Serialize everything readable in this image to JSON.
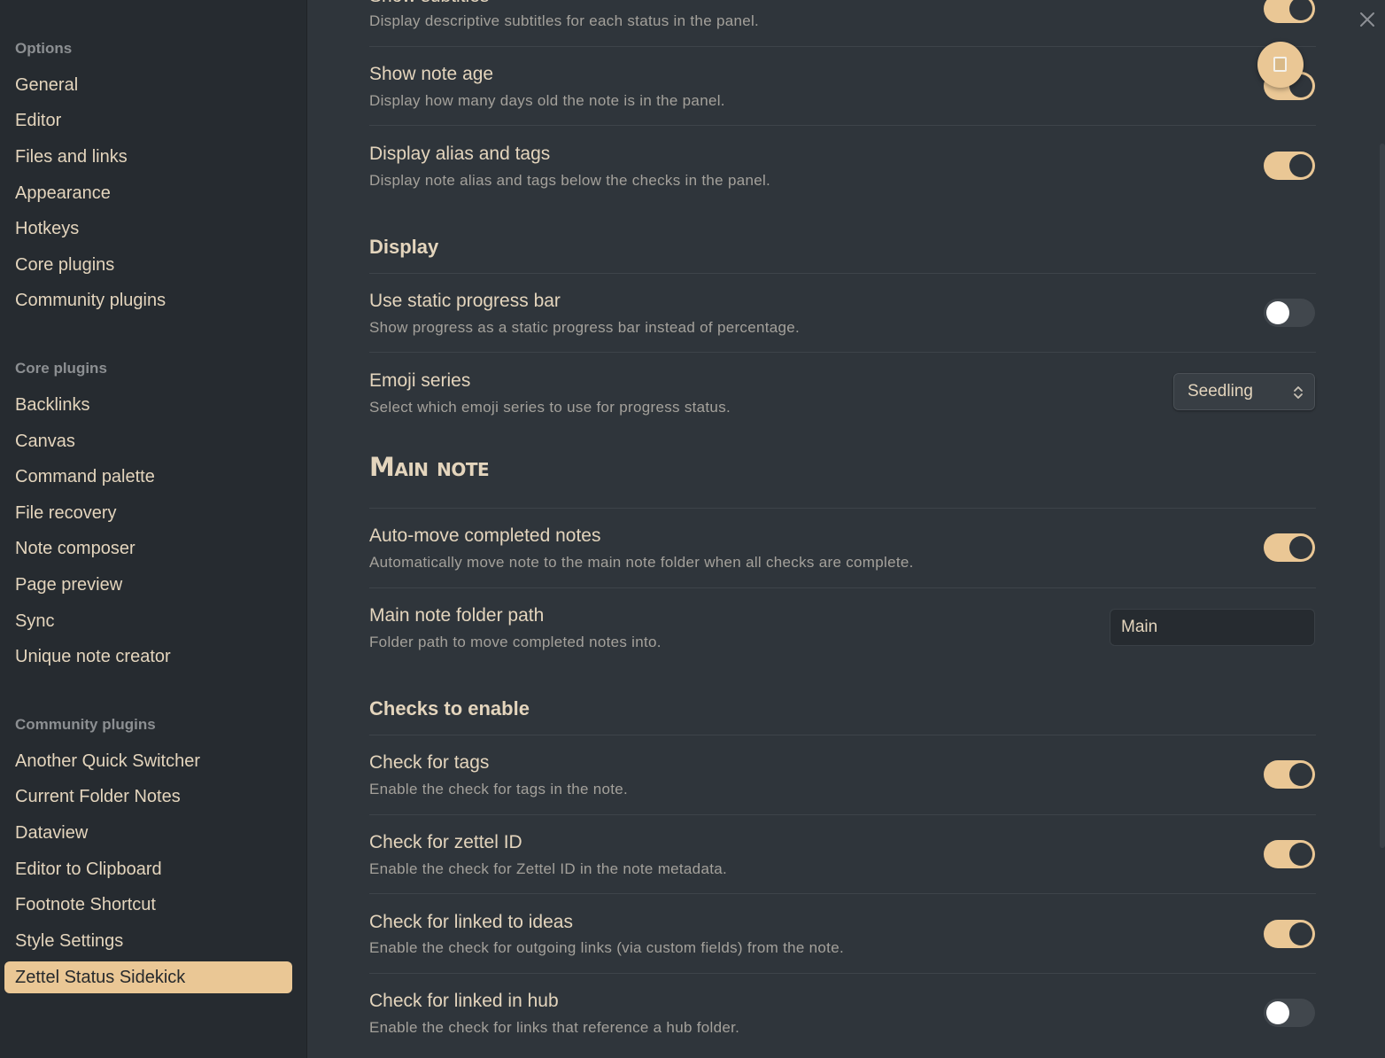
{
  "sidebar": {
    "options_title": "Options",
    "options": [
      "General",
      "Editor",
      "Files and links",
      "Appearance",
      "Hotkeys",
      "Core plugins",
      "Community plugins"
    ],
    "core_title": "Core plugins",
    "core": [
      "Backlinks",
      "Canvas",
      "Command palette",
      "File recovery",
      "Note composer",
      "Page preview",
      "Sync",
      "Unique note creator"
    ],
    "community_title": "Community plugins",
    "community": [
      "Another Quick Switcher",
      "Current Folder Notes",
      "Dataview",
      "Editor to Clipboard",
      "Footnote Shortcut",
      "Style Settings",
      "Zettel Status Sidekick"
    ],
    "active": "Zettel Status Sidekick"
  },
  "settings": {
    "show_subtitles": {
      "title": "Show subtitles",
      "desc": "Display descriptive subtitles for each status in the panel.",
      "enabled": true
    },
    "show_note_age": {
      "title": "Show note age",
      "desc": "Display how many days old the note is in the panel.",
      "enabled": true
    },
    "display_alias_tags": {
      "title": "Display alias and tags",
      "desc": "Display note alias and tags below the checks in the panel.",
      "enabled": true
    },
    "display_heading": "Display",
    "static_progress": {
      "title": "Use static progress bar",
      "desc": "Show progress as a static progress bar instead of percentage.",
      "enabled": false
    },
    "emoji_series": {
      "title": "Emoji series",
      "desc": "Select which emoji series to use for progress status.",
      "value": "Seedling"
    },
    "main_note_heading": "Main note",
    "auto_move": {
      "title": "Auto-move completed notes",
      "desc": "Automatically move note to the main note folder when all checks are complete.",
      "enabled": true
    },
    "folder_path": {
      "title": "Main note folder path",
      "desc": "Folder path to move completed notes into.",
      "value": "Main"
    },
    "checks_heading": "Checks to enable",
    "check_tags": {
      "title": "Check for tags",
      "desc": "Enable the check for tags in the note.",
      "enabled": true
    },
    "check_zettel_id": {
      "title": "Check for zettel ID",
      "desc": "Enable the check for Zettel ID in the note metadata.",
      "enabled": true
    },
    "check_linked_ideas": {
      "title": "Check for linked to ideas",
      "desc": "Enable the check for outgoing links (via custom fields) from the note.",
      "enabled": true
    },
    "check_linked_hub": {
      "title": "Check for linked in hub",
      "desc": "Enable the check for links that reference a hub folder.",
      "enabled": false
    }
  },
  "icons": {
    "close": "close-icon",
    "floating": "document-icon",
    "select_chevron": "chevron-updown-icon"
  },
  "colors": {
    "accent": "#eac795",
    "background": "#2f353b",
    "sidebar": "#262b30"
  }
}
